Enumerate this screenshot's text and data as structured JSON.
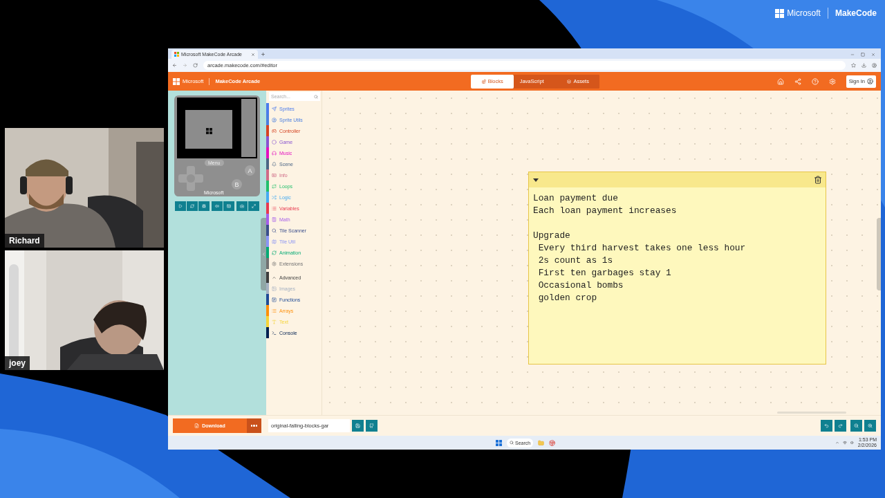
{
  "stream_logo": {
    "brand": "Microsoft",
    "product": "MakeCode"
  },
  "webcams": [
    {
      "name": "Richard"
    },
    {
      "name": "joey"
    }
  ],
  "browser": {
    "tab_title": "Microsoft MakeCode Arcade",
    "url": "arcade.makecode.com/#editor"
  },
  "header": {
    "brand": "Microsoft",
    "product": "MakeCode Arcade",
    "modes": [
      {
        "label": "Blocks",
        "selected": true
      },
      {
        "label": "JavaScript",
        "selected": false
      },
      {
        "label": "Assets",
        "selected": false
      }
    ],
    "sign_in": "Sign In"
  },
  "simulator": {
    "menu_label": "Menu",
    "button_a": "A",
    "button_b": "B",
    "brand": "Microsoft"
  },
  "toolbox": {
    "search_placeholder": "Search...",
    "categories": [
      {
        "label": "Sprites",
        "color": "#4b7bec",
        "kind": "category"
      },
      {
        "label": "Sprite Utils",
        "color": "#4a7fe0",
        "kind": "category"
      },
      {
        "label": "Controller",
        "color": "#d54322",
        "kind": "category"
      },
      {
        "label": "Game",
        "color": "#8854d0",
        "kind": "category"
      },
      {
        "label": "Music",
        "color": "#e30fc0",
        "kind": "category"
      },
      {
        "label": "Scene",
        "color": "#4b6584",
        "kind": "category"
      },
      {
        "label": "Info",
        "color": "#cf6a87",
        "kind": "category"
      },
      {
        "label": "Loops",
        "color": "#20bf6b",
        "kind": "category"
      },
      {
        "label": "Logic",
        "color": "#45aaf2",
        "kind": "category"
      },
      {
        "label": "Variables",
        "color": "#e8394f",
        "kind": "category"
      },
      {
        "label": "Math",
        "color": "#a55eea",
        "kind": "category"
      },
      {
        "label": "Tile Scanner",
        "color": "#3a4e8c",
        "kind": "category"
      },
      {
        "label": "Tile Util",
        "color": "#8a95f5",
        "kind": "category"
      },
      {
        "label": "Animation",
        "color": "#03aa74",
        "kind": "category"
      },
      {
        "label": "Extensions",
        "color": "#717171",
        "kind": "category"
      },
      {
        "label": "Advanced",
        "color": "#3d3d3d",
        "kind": "toggle",
        "expanded": true
      },
      {
        "label": "Images",
        "color": "#a5b1c2",
        "kind": "category"
      },
      {
        "label": "Functions",
        "color": "#1e4a96",
        "kind": "category"
      },
      {
        "label": "Arrays",
        "color": "#ff8f08",
        "kind": "category"
      },
      {
        "label": "Text",
        "color": "#f5d43a",
        "kind": "category"
      },
      {
        "label": "Console",
        "color": "#002050",
        "kind": "category"
      }
    ]
  },
  "comment": {
    "text": "Loan payment due\nEach loan payment increases\n\nUpgrade\n Every third harvest takes one less hour\n 2s count as 1s\n First ten garbages stay 1\n Occasional bombs\n golden crop"
  },
  "footer": {
    "download": "Download",
    "project_name": "original-falling-blocks-gar"
  },
  "taskbar": {
    "search": "Search",
    "time": "1:53 PM",
    "date": "2/2/2026"
  }
}
